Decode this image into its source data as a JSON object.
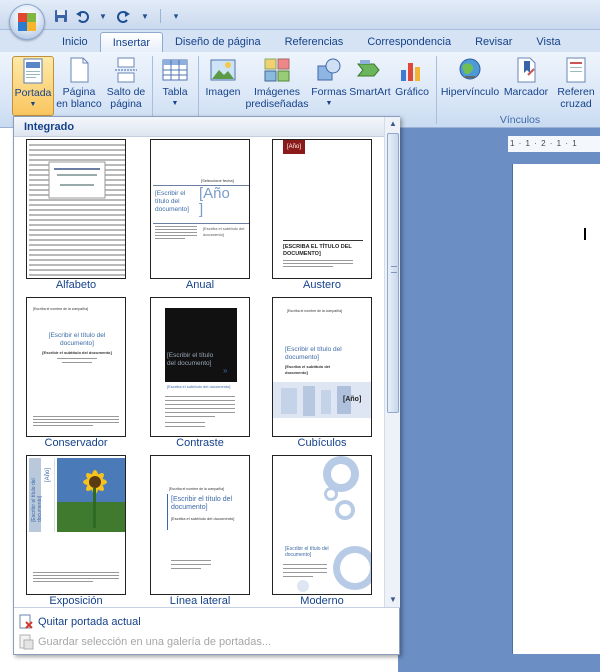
{
  "qat": {
    "icons": [
      "save-icon",
      "undo-icon",
      "redo-icon",
      "customize-icon"
    ]
  },
  "tabs": [
    {
      "label": "Inicio",
      "active": false
    },
    {
      "label": "Insertar",
      "active": true
    },
    {
      "label": "Diseño de página",
      "active": false
    },
    {
      "label": "Referencias",
      "active": false
    },
    {
      "label": "Correspondencia",
      "active": false
    },
    {
      "label": "Revisar",
      "active": false
    },
    {
      "label": "Vista",
      "active": false
    }
  ],
  "ribbon": {
    "portada": "Portada",
    "pagina": "Página",
    "en_blanco": "en blanco",
    "salto": "Salto de",
    "pagina2": "página",
    "tabla": "Tabla",
    "imagen": "Imagen",
    "imagenes": "Imágenes",
    "prediseñadas": "prediseñadas",
    "formas": "Formas",
    "smartart": "SmartArt",
    "grafico": "Gráfico",
    "hipervinculo": "Hipervínculo",
    "marcador": "Marcador",
    "referencia": "Referen",
    "cruzada": "cruzad",
    "vinculos_group": "Vínculos"
  },
  "ruler": "1 · 1 · 2 · 1 · 1",
  "gallery": {
    "header": "Integrado",
    "covers": [
      {
        "label": "Alfabeto"
      },
      {
        "label": "Anual"
      },
      {
        "label": "Austero"
      },
      {
        "label": "Conservador"
      },
      {
        "label": "Contraste"
      },
      {
        "label": "Cubículos"
      },
      {
        "label": "Exposición"
      },
      {
        "label": "Línea lateral"
      },
      {
        "label": "Moderno"
      }
    ],
    "remove_label": "Quitar portada actual",
    "save_label": "Guardar selección en una galería de portadas..."
  },
  "cover_text": {
    "anual_date": "[Seleccione fecha]",
    "anual_title": "[Escribir el título del documento]",
    "anual_year": "[Año",
    "anual_year_close": "]",
    "anual_subtitle": "[Escriba el subtítulo del documento]",
    "austero_year": "[Año]",
    "austero_title": "[ESCRIBA EL TÍTULO DEL DOCUMENTO]",
    "conservador_company": "[Escriba el nombre de la compañía]",
    "conservador_title": "[Escribir el título del documento]",
    "conservador_subtitle": "[Escribir el subtítulo del documento]",
    "contraste_title": "[Escribir el título del documento]",
    "contraste_subtitle": "[Escriba el subtítulo del documento]",
    "cubiculos_company": "[Escriba el nombre de la compañía]",
    "cubiculos_title": "[Escribir el título del documento]",
    "cubiculos_subtitle": "[Escriba el subtítulo del documento]",
    "cubiculos_year": "[Año]",
    "exposicion_year": "[Año]",
    "exposicion_title": "[Escribir el título del documento]",
    "lateral_company": "[Escriba el nombre de la compañía]",
    "lateral_title": "[Escribir el título del documento]",
    "lateral_subtitle": "[Escriba el subtítulo del documento]",
    "moderno_title": "[Escribir el título del documento]"
  },
  "colors": {
    "accent": "#15428b",
    "pressed": "#f9c65f",
    "doc_bg": "#6b8fc4",
    "austero_red": "#8b1a1a"
  }
}
